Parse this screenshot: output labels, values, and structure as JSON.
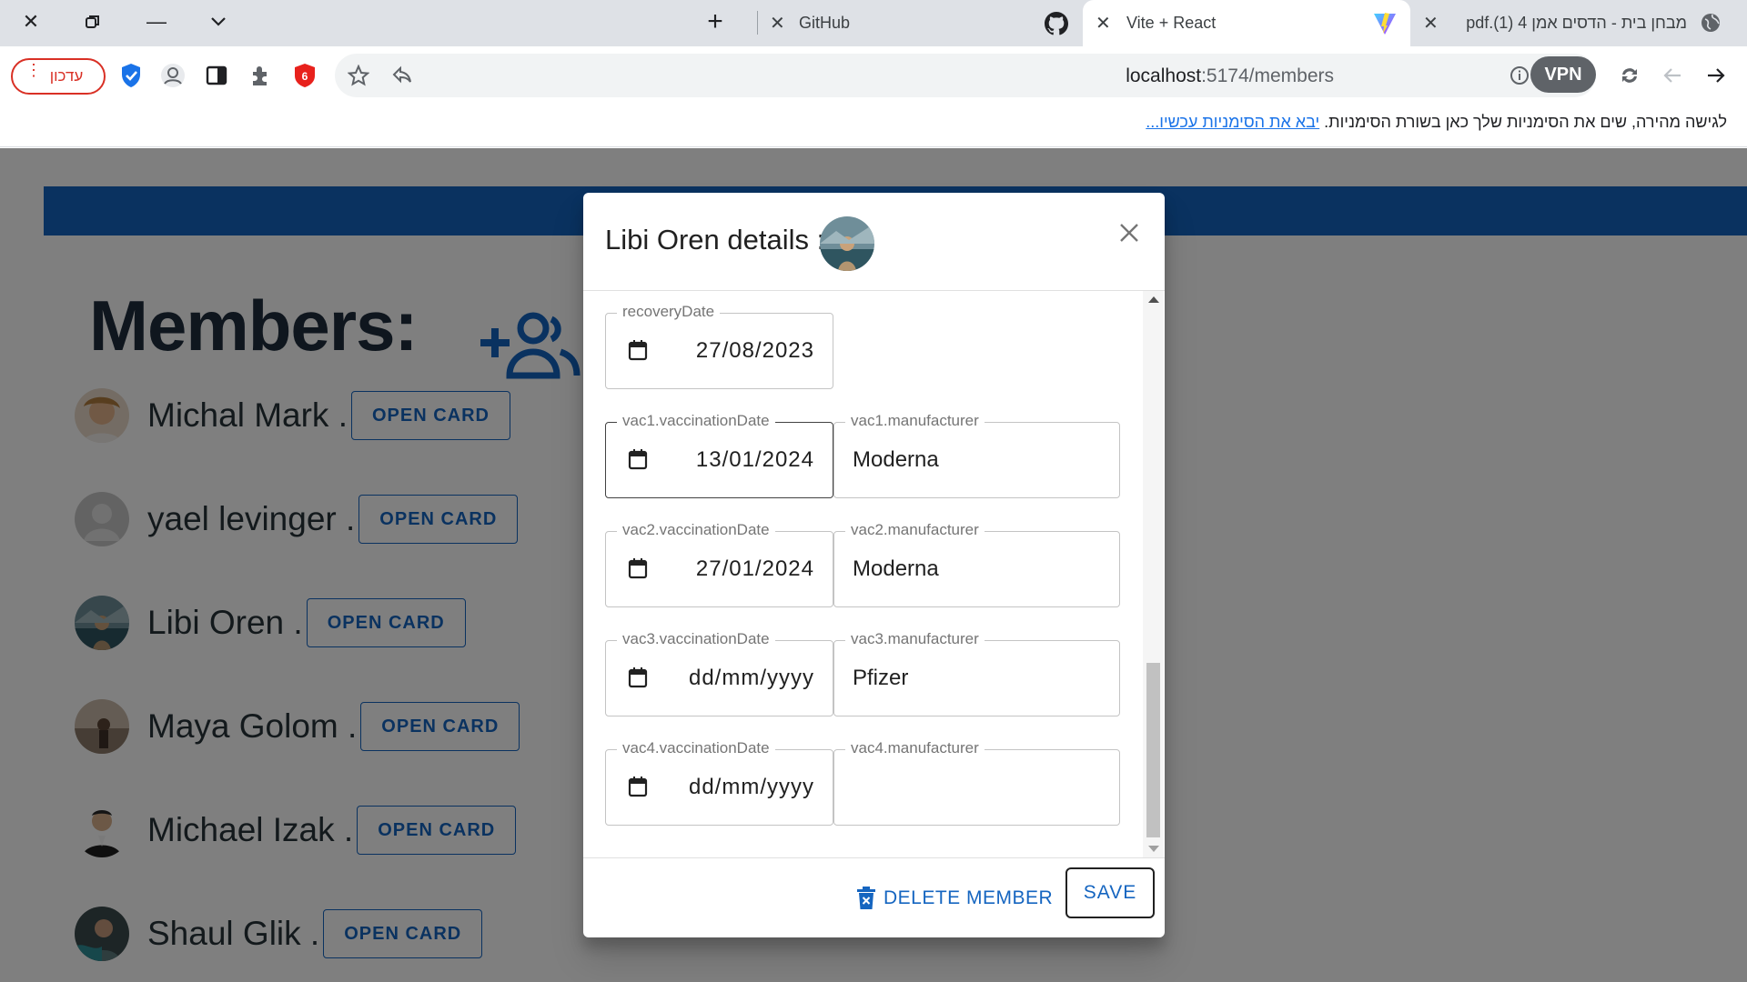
{
  "browser": {
    "tabs": [
      {
        "label": "GitHub"
      },
      {
        "label": "Vite + React"
      },
      {
        "label": "מבחן בית - הדסים אמן 4 (1).pdf"
      }
    ],
    "url_host": "localhost",
    "url_path": ":5174/members",
    "update_label": "עדכון",
    "vpn_label": "VPN",
    "bookmark_message": "לגישה מהירה, שים את הסימניות שלך כאן בשורת הסימניות.",
    "bookmark_link": "יבא את הסימניות עכשיו..."
  },
  "page": {
    "title": "Members:",
    "open_card_label": "OPEN CARD",
    "members": [
      {
        "name": "Michal Mark ."
      },
      {
        "name": "yael levinger ."
      },
      {
        "name": "Libi Oren ."
      },
      {
        "name": "Maya Golom ."
      },
      {
        "name": "Michael Izak ."
      },
      {
        "name": "Shaul Glik ."
      }
    ]
  },
  "dialog": {
    "title": "Libi Oren details :",
    "fields": {
      "recovery_label": "recoveryDate",
      "recovery_value": "27/08/2023",
      "vac1_date_label": "vac1.vaccinationDate",
      "vac1_date_value": "13/01/2024",
      "vac1_man_label": "vac1.manufacturer",
      "vac1_man_value": "Moderna",
      "vac2_date_label": "vac2.vaccinationDate",
      "vac2_date_value": "27/01/2024",
      "vac2_man_label": "vac2.manufacturer",
      "vac2_man_value": "Moderna",
      "vac3_date_label": "vac3.vaccinationDate",
      "vac3_date_value": "dd/mm/yyyy",
      "vac3_man_label": "vac3.manufacturer",
      "vac3_man_value": "Pfizer",
      "vac4_date_label": "vac4.vaccinationDate",
      "vac4_date_value": "dd/mm/yyyy",
      "vac4_man_label": "vac4.manufacturer",
      "vac4_man_value": ""
    },
    "delete_label": "DELETE MEMBER",
    "save_label": "SAVE"
  },
  "colors": {
    "primary": "#1565c0",
    "appbar": "#1565c0",
    "danger": "#d93025"
  }
}
